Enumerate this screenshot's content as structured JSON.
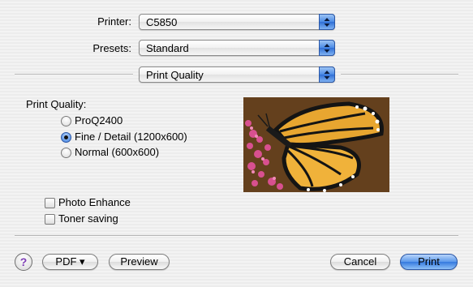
{
  "printer": {
    "label": "Printer:",
    "value": "C5850"
  },
  "presets": {
    "label": "Presets:",
    "value": "Standard"
  },
  "panel": {
    "value": "Print Quality"
  },
  "print_quality": {
    "heading": "Print Quality:",
    "options": [
      {
        "label": "ProQ2400",
        "selected": false
      },
      {
        "label": "Fine / Detail (1200x600)",
        "selected": true
      },
      {
        "label": "Normal (600x600)",
        "selected": false
      }
    ]
  },
  "checkboxes": [
    {
      "label": "Photo Enhance",
      "checked": false
    },
    {
      "label": "Toner saving",
      "checked": false
    }
  ],
  "buttons": {
    "help": "?",
    "pdf": "PDF ▾",
    "preview": "Preview",
    "cancel": "Cancel",
    "print": "Print"
  },
  "preview_image": {
    "subject": "monarch-butterfly-on-pink-flowers"
  },
  "colors": {
    "accent": "#3579df",
    "background": "#ececec"
  }
}
